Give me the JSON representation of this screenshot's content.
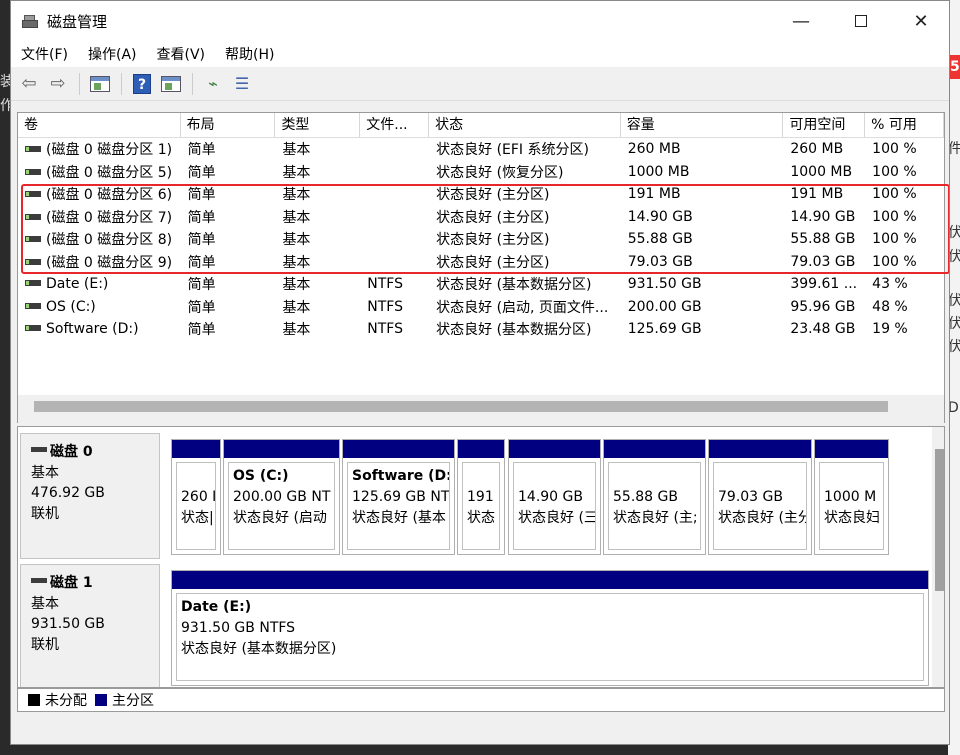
{
  "window": {
    "title": "磁盘管理"
  },
  "menu": [
    "文件(F)",
    "操作(A)",
    "查看(V)",
    "帮助(H)"
  ],
  "toolbar": {
    "icons": [
      "back-arrow-icon",
      "forward-arrow-icon",
      "properties-icon",
      "help-icon",
      "show-pane-icon",
      "connect-icon",
      "settings-list-icon"
    ]
  },
  "background": {
    "left_fragments": [
      "装",
      "作"
    ],
    "right_fragments": [
      "件",
      "伏",
      "伏",
      "伏",
      "伏",
      "伏",
      "D:"
    ],
    "badge": "5"
  },
  "volume_list": {
    "columns": [
      "卷",
      "布局",
      "类型",
      "文件...",
      "状态",
      "容量",
      "可用空间",
      "% 可用"
    ],
    "rows": [
      [
        "(磁盘 0 磁盘分区 1)",
        "简单",
        "基本",
        "",
        "状态良好 (EFI 系统分区)",
        "260 MB",
        "260 MB",
        "100 %"
      ],
      [
        "(磁盘 0 磁盘分区 5)",
        "简单",
        "基本",
        "",
        "状态良好 (恢复分区)",
        "1000 MB",
        "1000 MB",
        "100 %"
      ],
      [
        "(磁盘 0 磁盘分区 6)",
        "简单",
        "基本",
        "",
        "状态良好 (主分区)",
        "191 MB",
        "191 MB",
        "100 %"
      ],
      [
        "(磁盘 0 磁盘分区 7)",
        "简单",
        "基本",
        "",
        "状态良好 (主分区)",
        "14.90 GB",
        "14.90 GB",
        "100 %"
      ],
      [
        "(磁盘 0 磁盘分区 8)",
        "简单",
        "基本",
        "",
        "状态良好 (主分区)",
        "55.88 GB",
        "55.88 GB",
        "100 %"
      ],
      [
        "(磁盘 0 磁盘分区 9)",
        "简单",
        "基本",
        "",
        "状态良好 (主分区)",
        "79.03 GB",
        "79.03 GB",
        "100 %"
      ],
      [
        "Date (E:)",
        "简单",
        "基本",
        "NTFS",
        "状态良好 (基本数据分区)",
        "931.50 GB",
        "399.61 ...",
        "43 %"
      ],
      [
        "OS (C:)",
        "简单",
        "基本",
        "NTFS",
        "状态良好 (启动, 页面文件...",
        "200.00 GB",
        "95.96 GB",
        "48 %"
      ],
      [
        "Software (D:)",
        "简单",
        "基本",
        "NTFS",
        "状态良好 (基本数据分区)",
        "125.69 GB",
        "23.48 GB",
        "19 %"
      ]
    ]
  },
  "disks": [
    {
      "name": "磁盘 0",
      "type": "基本",
      "size": "476.92 GB",
      "state": "联机",
      "partitions": [
        {
          "name": "",
          "size": "260 I",
          "status": "状态|"
        },
        {
          "name": "OS  (C:)",
          "size": "200.00 GB NT",
          "status": "状态良好 (启动"
        },
        {
          "name": "Software  (D:",
          "size": "125.69 GB NT",
          "status": "状态良好 (基本"
        },
        {
          "name": "",
          "size": "191",
          "status": "状态"
        },
        {
          "name": "",
          "size": "14.90 GB",
          "status": "状态良好 (三"
        },
        {
          "name": "",
          "size": "55.88 GB",
          "status": "状态良好 (主;"
        },
        {
          "name": "",
          "size": "79.03 GB",
          "status": "状态良好 (主分"
        },
        {
          "name": "",
          "size": "1000 M",
          "status": "状态良妇"
        }
      ]
    },
    {
      "name": "磁盘 1",
      "type": "基本",
      "size": "931.50 GB",
      "state": "联机",
      "partitions": [
        {
          "name": "Date  (E:)",
          "size": "931.50 GB NTFS",
          "status": "状态良好 (基本数据分区)"
        }
      ]
    }
  ],
  "legend": [
    {
      "label": "未分配",
      "color": "#000000"
    },
    {
      "label": "主分区",
      "color": "#000080"
    }
  ]
}
